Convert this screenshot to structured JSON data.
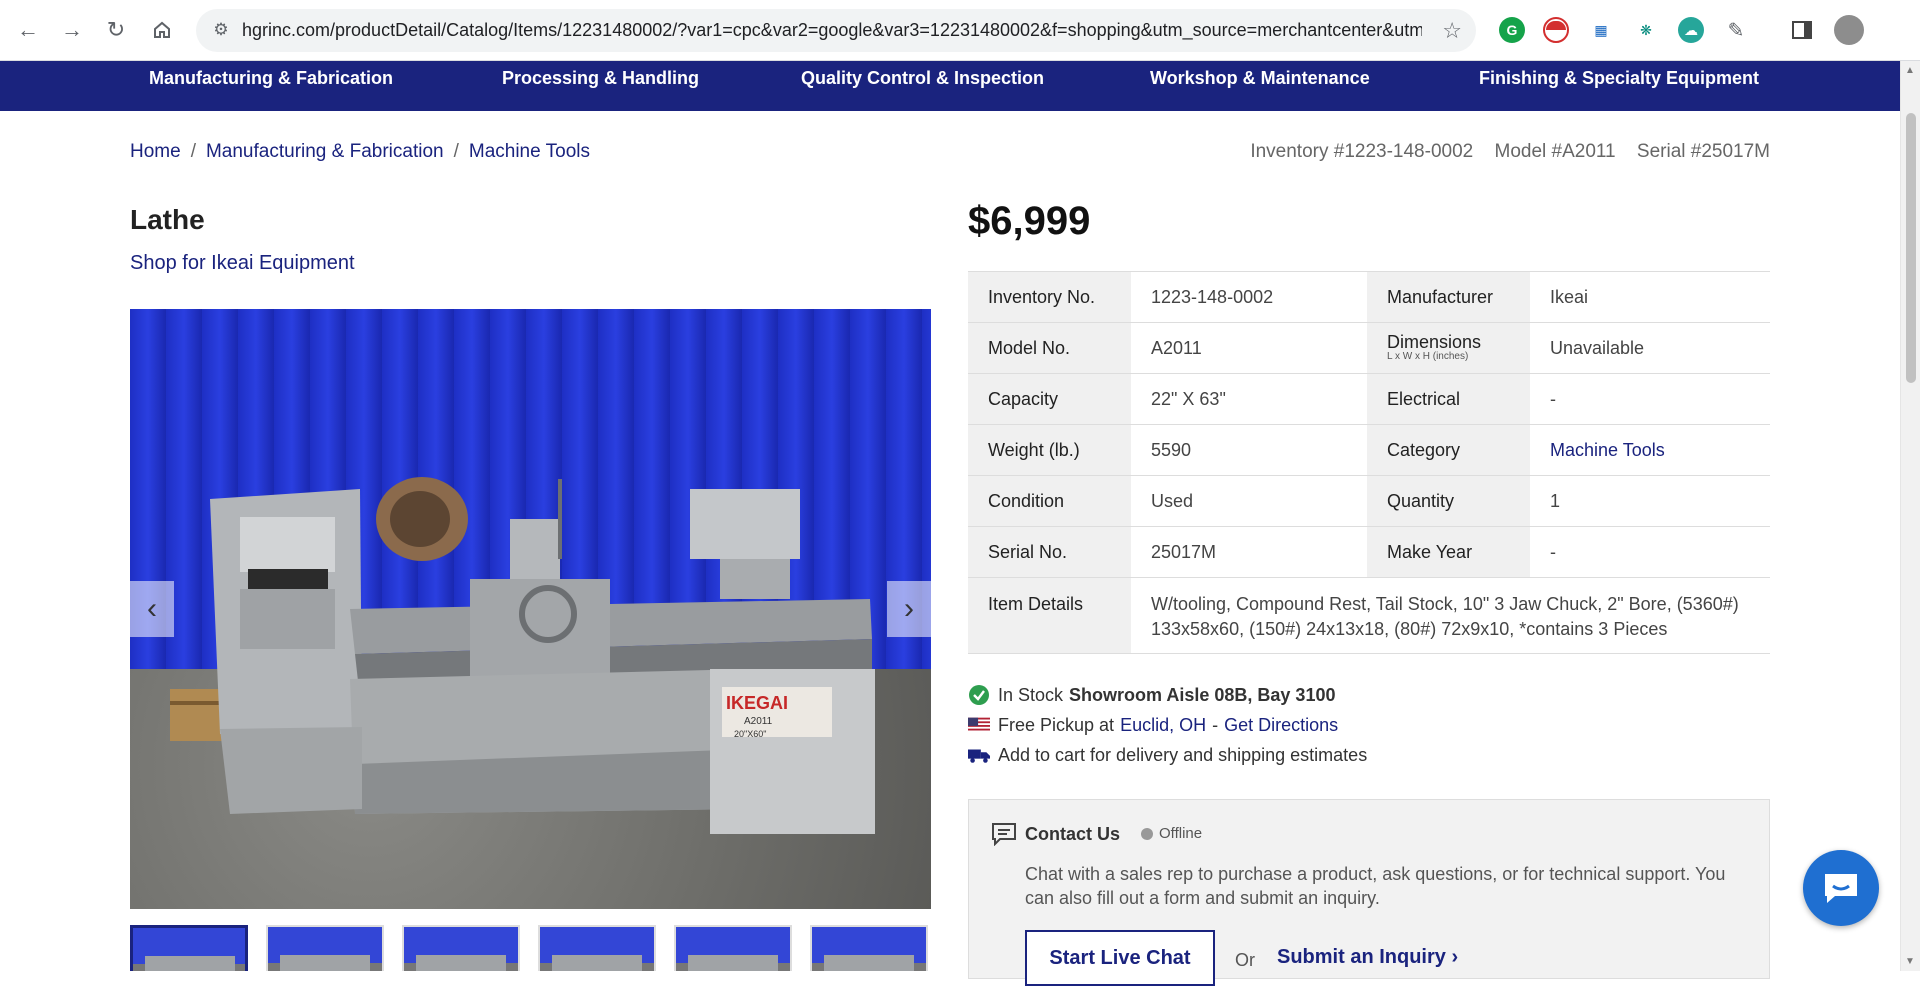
{
  "browser": {
    "url": "hgrinc.com/productDetail/Catalog/Items/12231480002/?var1=cpc&var2=google&var3=12231480002&f=shopping&utm_source=merchantcenter&utm...",
    "icons": [
      "back-icon",
      "forward-icon",
      "reload-icon",
      "home-icon",
      "site-info-icon",
      "bookmark-star-icon",
      "extensions-icon",
      "sidebar-icon",
      "profile-avatar"
    ]
  },
  "nav": {
    "items": [
      {
        "label": "Manufacturing & Fabrication"
      },
      {
        "label": "Processing & Handling"
      },
      {
        "label": "Quality Control & Inspection"
      },
      {
        "label": "Workshop & Maintenance"
      },
      {
        "label": "Finishing & Specialty Equipment"
      }
    ]
  },
  "breadcrumb": {
    "items": [
      "Home",
      "Manufacturing & Fabrication",
      "Machine Tools"
    ],
    "separator": "/"
  },
  "identifiers": {
    "inventory": "Inventory #1223-148-0002",
    "model": "Model #A2011",
    "serial": "Serial #25017M"
  },
  "product": {
    "title": "Lathe",
    "shop_link": "Shop for Ikeai Equipment",
    "price": "$6,999",
    "image_label": "IKEGAI",
    "image_sublabel": "A2011",
    "image_size": "20\"X60\""
  },
  "specs": {
    "rows": [
      {
        "l1": "Inventory No.",
        "v1": "1223-148-0002",
        "l2": "Manufacturer",
        "v2": "Ikeai"
      },
      {
        "l1": "Model No.",
        "v1": "A2011",
        "l2": "Dimensions",
        "l2_sub": "L x W x H (inches)",
        "v2": "Unavailable"
      },
      {
        "l1": "Capacity",
        "v1": "22\" X 63\"",
        "l2": "Electrical",
        "v2": "-"
      },
      {
        "l1": "Weight (lb.)",
        "v1": "5590",
        "l2": "Category",
        "v2": "Machine Tools"
      },
      {
        "l1": "Condition",
        "v1": "Used",
        "l2": "Quantity",
        "v2": "1"
      },
      {
        "l1": "Serial No.",
        "v1": "25017M",
        "l2": "Make Year",
        "v2": "-"
      }
    ],
    "details_label": "Item Details",
    "details_value": "W/tooling, Compound Rest, Tail Stock, 10\" 3 Jaw Chuck, 2\" Bore, (5360#) 133x58x60, (150#) 24x13x18, (80#) 72x9x10, *contains 3 Pieces"
  },
  "availability": {
    "stock_label": "In Stock",
    "stock_location": "Showroom Aisle 08B, Bay 3100",
    "pickup_label": "Free Pickup at",
    "pickup_location": "Euclid, OH",
    "pickup_sep": "-",
    "directions": "Get Directions",
    "shipping": "Add to cart for delivery and shipping estimates"
  },
  "contact": {
    "title": "Contact Us",
    "status": "Offline",
    "description": "Chat with a sales rep to purchase a product, ask questions, or for technical support. You can also fill out a form and submit an inquiry.",
    "chat_button": "Start Live Chat",
    "or": "Or",
    "inquiry_link": "Submit an Inquiry ›"
  },
  "colors": {
    "brand_navy": "#1a237e",
    "in_stock_green": "#2e9e4f",
    "chat_blue": "#1f6fd1"
  }
}
